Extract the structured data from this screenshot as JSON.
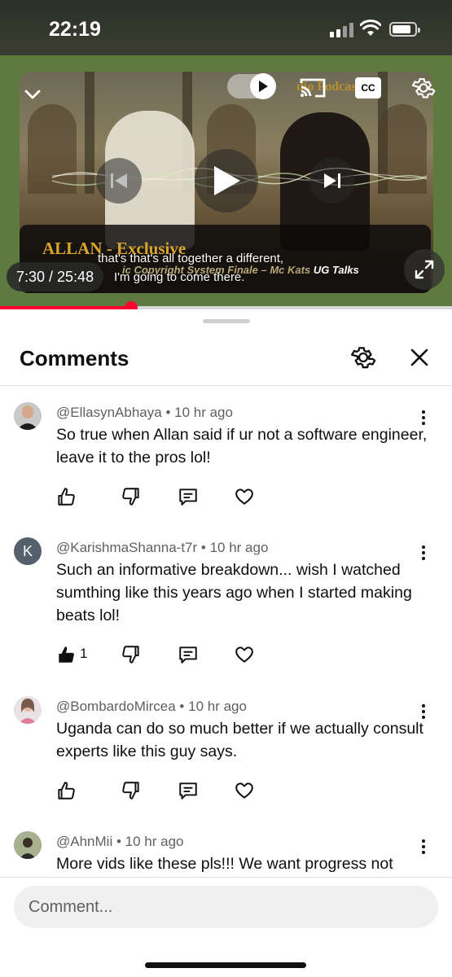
{
  "status_bar": {
    "time": "22:19"
  },
  "player": {
    "banner_title": "ALLAN - Exclusive",
    "banner_subtitle_italic": "ic Copyright System Finale – Mc Kats",
    "banner_subtitle_bold": "UG Talks",
    "watermark": "dio Podcast",
    "caption_line1": "that's that's all together a different,",
    "caption_line2": "I'm going to come there.",
    "timecode": "7:30 / 25:48",
    "progress_fraction": 0.29,
    "cc_label": "CC"
  },
  "sheet": {
    "title": "Comments"
  },
  "comments": [
    {
      "author": "@EllasynAbhaya",
      "time": "10 hr ago",
      "text": "So true when Allan said if ur not a software engineer, leave it to the pros lol!",
      "avatar_type": "photo-man",
      "like_count": ""
    },
    {
      "author": "@KarishmaShanna-t7r",
      "time": "10 hr ago",
      "text": "Such an informative breakdown... wish I watched sumthing like this years ago when I started making beats lol!",
      "avatar_type": "letter",
      "avatar_letter": "K",
      "like_count": "1"
    },
    {
      "author": "@BombardoMircea",
      "time": "10 hr ago",
      "text": "Uganda can do so much better if we actually consult experts like this guy says.",
      "avatar_type": "photo-woman",
      "like_count": ""
    },
    {
      "author": "@AhnMii",
      "time": "10 hr ago",
      "text": "More vids like these pls!!! We want progress not",
      "avatar_type": "photo-person",
      "like_count": ""
    }
  ],
  "comment_input": {
    "placeholder": "Comment..."
  },
  "colors": {
    "accent_red": "#ff0033",
    "player_bg": "#5e7a3e",
    "meta_gray": "#606060"
  },
  "icons": [
    "chevron-down-icon",
    "autoplay-toggle-icon",
    "cast-icon",
    "cc-icon",
    "settings-gear-icon",
    "previous-icon",
    "play-icon",
    "next-icon",
    "fullscreen-icon",
    "close-icon",
    "thumbs-up-icon",
    "thumbs-down-icon",
    "reply-icon",
    "heart-icon",
    "more-vert-icon"
  ]
}
